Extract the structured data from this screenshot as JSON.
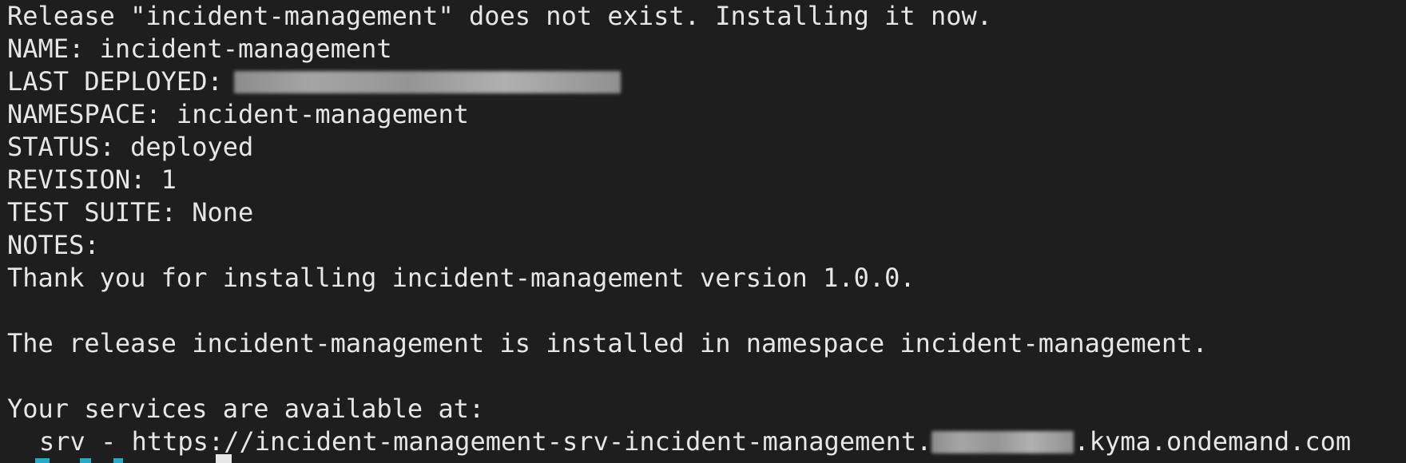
{
  "terminal": {
    "lines": {
      "release_message": "Release \"incident-management\" does not exist. Installing it now.",
      "name": "NAME: incident-management",
      "last_deployed_label": "LAST DEPLOYED:",
      "namespace": "NAMESPACE: incident-management",
      "status": "STATUS: deployed",
      "revision": "REVISION: 1",
      "test_suite": "TEST SUITE: None",
      "notes": "NOTES:",
      "thank_you": "Thank you for installing incident-management version 1.0.0.",
      "release_installed": "The release incident-management is installed in namespace incident-management.",
      "services_available": "Your services are available at:",
      "srv_prefix": "srv - https://incident-management-srv-incident-management.",
      "srv_suffix": ".kyma.ondemand.com"
    },
    "colors": {
      "background": "#1e1e1e",
      "foreground": "#e6e6e6",
      "prompt": "#2aa8c8"
    }
  }
}
